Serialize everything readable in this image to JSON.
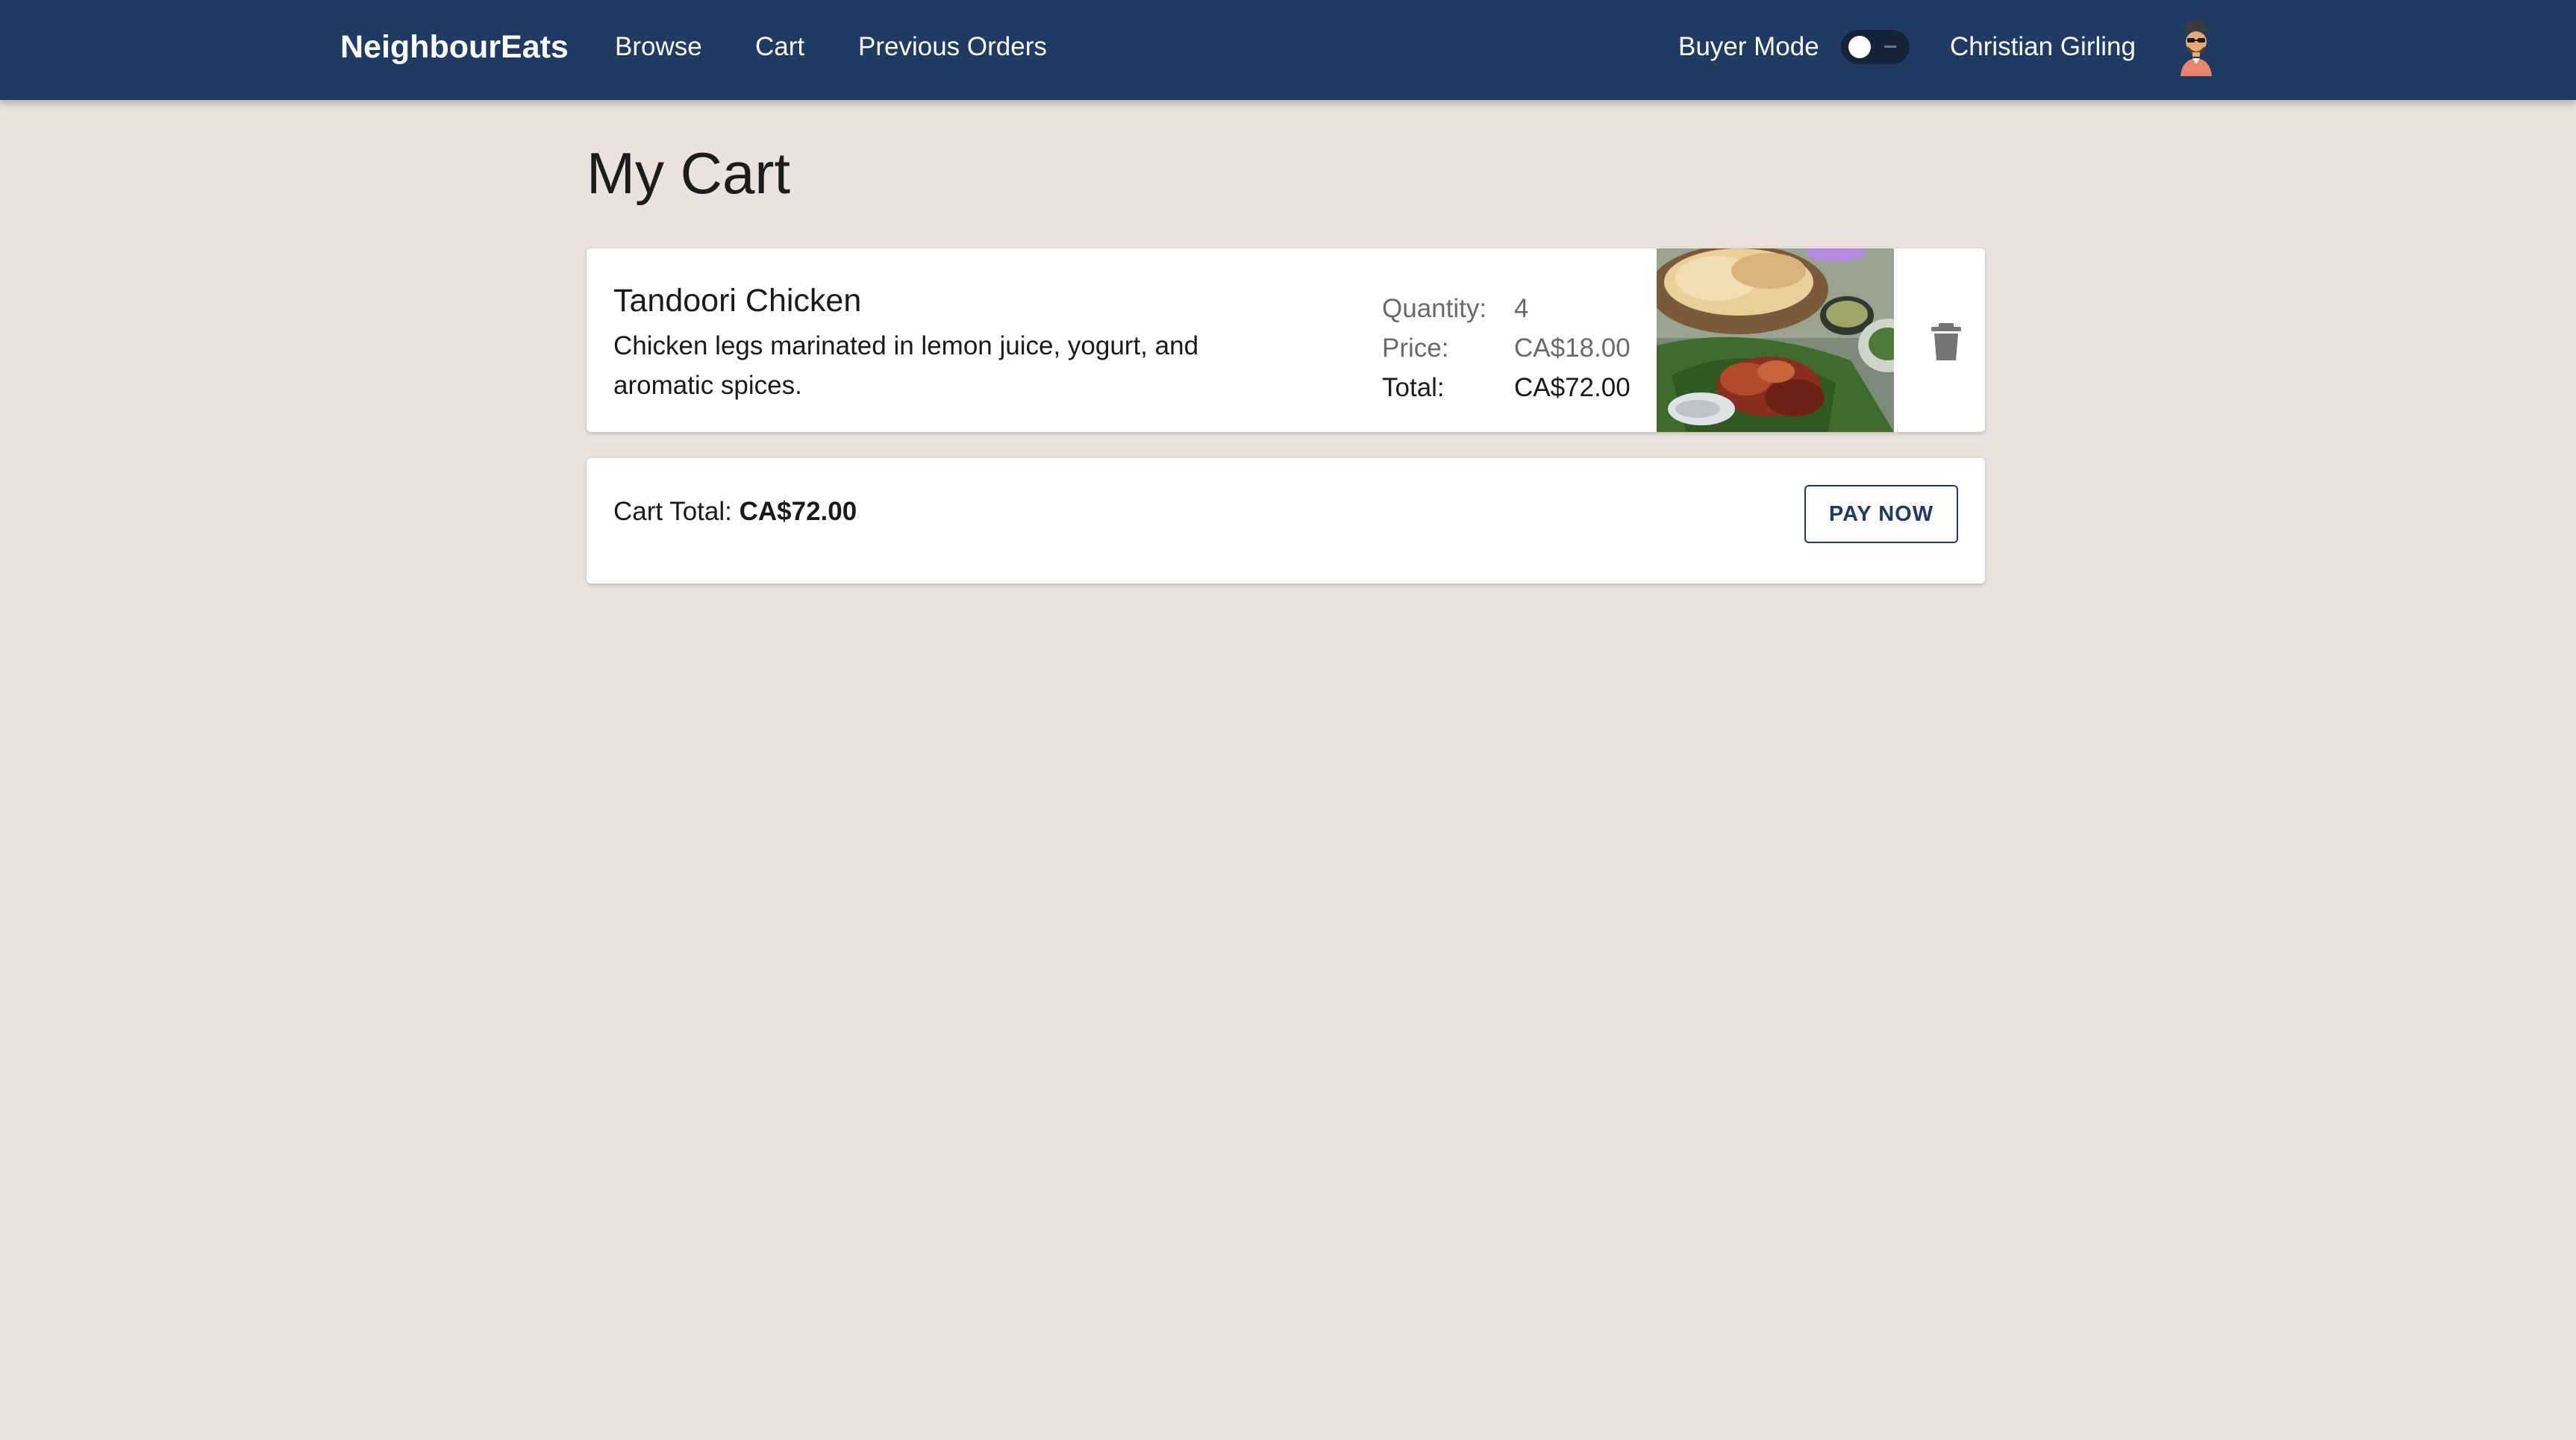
{
  "app": {
    "brand": "NeighbourEats",
    "nav": [
      "Browse",
      "Cart",
      "Previous Orders"
    ],
    "mode_label": "Buyer Mode",
    "mode_toggle_on": false,
    "user_name": "Christian Girling",
    "avatar_icon": "person-with-hat-avatar"
  },
  "page": {
    "title": "My Cart"
  },
  "cart": {
    "items": [
      {
        "name": "Tandoori Chicken",
        "description": "Chicken legs marinated in lemon juice, yogurt, and aromatic spices.",
        "quantity_label": "Quantity:",
        "quantity": "4",
        "price_label": "Price:",
        "price": "CA$18.00",
        "total_label": "Total:",
        "total": "CA$72.00",
        "image": "tandoori-chicken-photo",
        "delete_icon": "trash-icon"
      }
    ],
    "total_label": "Cart Total:",
    "total_value": "CA$72.00",
    "pay_label": "PAY NOW"
  },
  "colors": {
    "header": "#1f3a63",
    "background": "#ebe1dd",
    "card": "#ffffff",
    "accent": "#1f3a63"
  }
}
